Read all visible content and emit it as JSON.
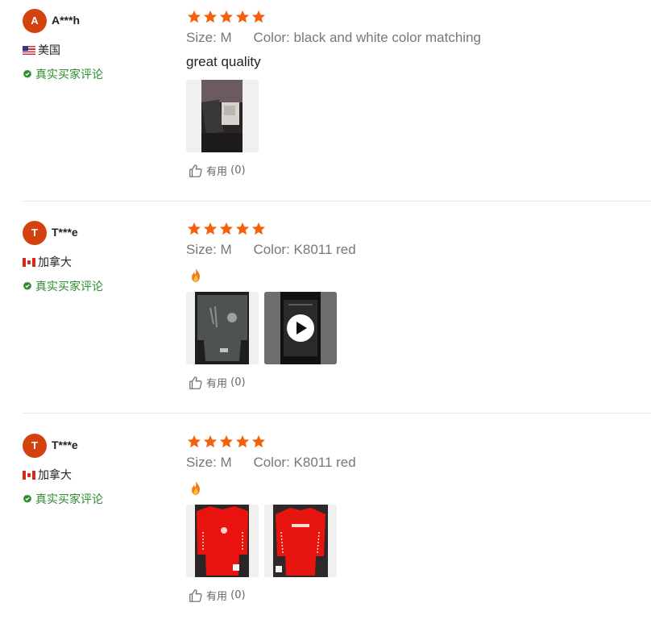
{
  "colors": {
    "star": "#f4600c",
    "verified": "#2e8b2e",
    "avatar": "#d4430f",
    "attribute_text": "#777777",
    "divider": "#e9e9e9"
  },
  "reviews": [
    {
      "avatar_letter": "A",
      "username": "A***h",
      "flag_icon": "us-flag-icon",
      "country": "美国",
      "verified_label": "真实买家评论",
      "rating": 5,
      "size_label": "Size:",
      "size_value": "M",
      "color_label": "Color:",
      "color_value": "black and white color matching",
      "text": "great quality",
      "media": [
        {
          "type": "image",
          "icon": "photo-black-hoodie"
        }
      ],
      "helpful_label": "有用",
      "helpful_count": "(0)"
    },
    {
      "avatar_letter": "T",
      "username": "T***e",
      "flag_icon": "canada-flag-icon",
      "country": "加拿大",
      "verified_label": "真实买家评论",
      "rating": 5,
      "size_label": "Size:",
      "size_value": "M",
      "color_label": "Color:",
      "color_value": "K8011 red",
      "text_icon": "fire-emoji",
      "media": [
        {
          "type": "image",
          "icon": "photo-grey-jacket"
        },
        {
          "type": "video",
          "icon": "play-icon"
        }
      ],
      "helpful_label": "有用",
      "helpful_count": "(0)"
    },
    {
      "avatar_letter": "T",
      "username": "T***e",
      "flag_icon": "canada-flag-icon",
      "country": "加拿大",
      "verified_label": "真实买家评论",
      "rating": 5,
      "size_label": "Size:",
      "size_value": "M",
      "color_label": "Color:",
      "color_value": "K8011 red",
      "text_icon": "fire-emoji",
      "media": [
        {
          "type": "image",
          "icon": "photo-red-shirt-front"
        },
        {
          "type": "image",
          "icon": "photo-red-shirt-back"
        }
      ],
      "helpful_label": "有用",
      "helpful_count": "(0)"
    }
  ]
}
